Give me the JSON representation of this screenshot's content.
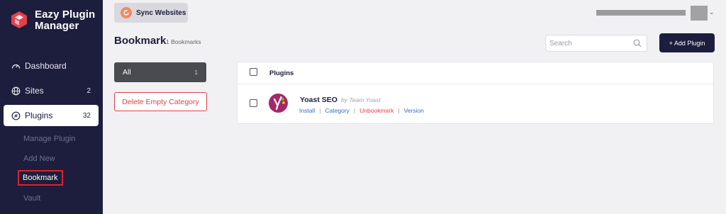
{
  "app": {
    "brand_line1": "Eazy Plugin",
    "brand_line2": "Manager"
  },
  "sidebar": {
    "items": [
      {
        "label": "Dashboard",
        "icon": "gauge-icon",
        "count": ""
      },
      {
        "label": "Sites",
        "icon": "globe-icon",
        "count": "2"
      },
      {
        "label": "Plugins",
        "icon": "plugin-icon",
        "count": "32"
      }
    ],
    "sub_items": [
      "Manage Plugin",
      "Add New",
      "Bookmark",
      "Vault"
    ]
  },
  "topbar": {
    "sync_label": "Sync Websites"
  },
  "page": {
    "title": "Bookmark",
    "count_text": "1 Bookmarks"
  },
  "search": {
    "placeholder": "Search"
  },
  "actions": {
    "add_label": "+ Add Plugin"
  },
  "filters": {
    "all_label": "All",
    "all_count": "1",
    "delete_label": "Delete Empty Category"
  },
  "table": {
    "header": "Plugins",
    "rows": [
      {
        "name": "Yoast SEO",
        "author": "by Team Yoast",
        "actions": [
          "Install",
          "Category",
          "Unbookmark",
          "Version"
        ]
      }
    ]
  },
  "colors": {
    "sidebar": "#1d1d3d",
    "accent_red": "#e0424b",
    "link": "#3a6fb5",
    "sync_badge": "#ef8a63",
    "yoast": "#a4286a"
  }
}
